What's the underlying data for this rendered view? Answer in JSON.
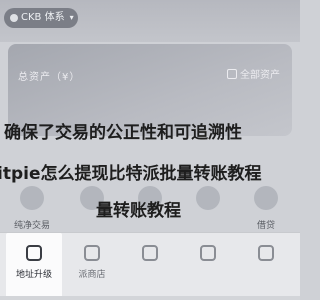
{
  "header": {
    "network_label": "CKB 体系",
    "network_chevron": "▾"
  },
  "asset_card": {
    "label": "总资产（¥）",
    "all_assets_label": "全部资产"
  },
  "quick_actions": [
    {
      "label": "纯净交易",
      "icon": "trade-icon"
    },
    {
      "label": "",
      "icon": "transfer-icon"
    },
    {
      "label": "",
      "icon": "swap-icon"
    },
    {
      "label": "",
      "icon": "stake-icon"
    },
    {
      "label": "借贷",
      "icon": "loan-icon"
    }
  ],
  "overlay_text": {
    "line1": "确保了交易的公正性和可追溯性",
    "line2": "itpie怎么提现比特派批量转账教程",
    "line3": "量转账教程"
  },
  "bottom_nav": [
    {
      "label": "地址升级",
      "icon": "upgrade-icon",
      "active": true
    },
    {
      "label": "派商店",
      "icon": "store-icon",
      "active": false
    },
    {
      "label": "",
      "icon": "discover-icon",
      "active": false
    },
    {
      "label": "",
      "icon": "message-icon",
      "active": false
    },
    {
      "label": "",
      "icon": "profile-icon",
      "active": false
    }
  ]
}
